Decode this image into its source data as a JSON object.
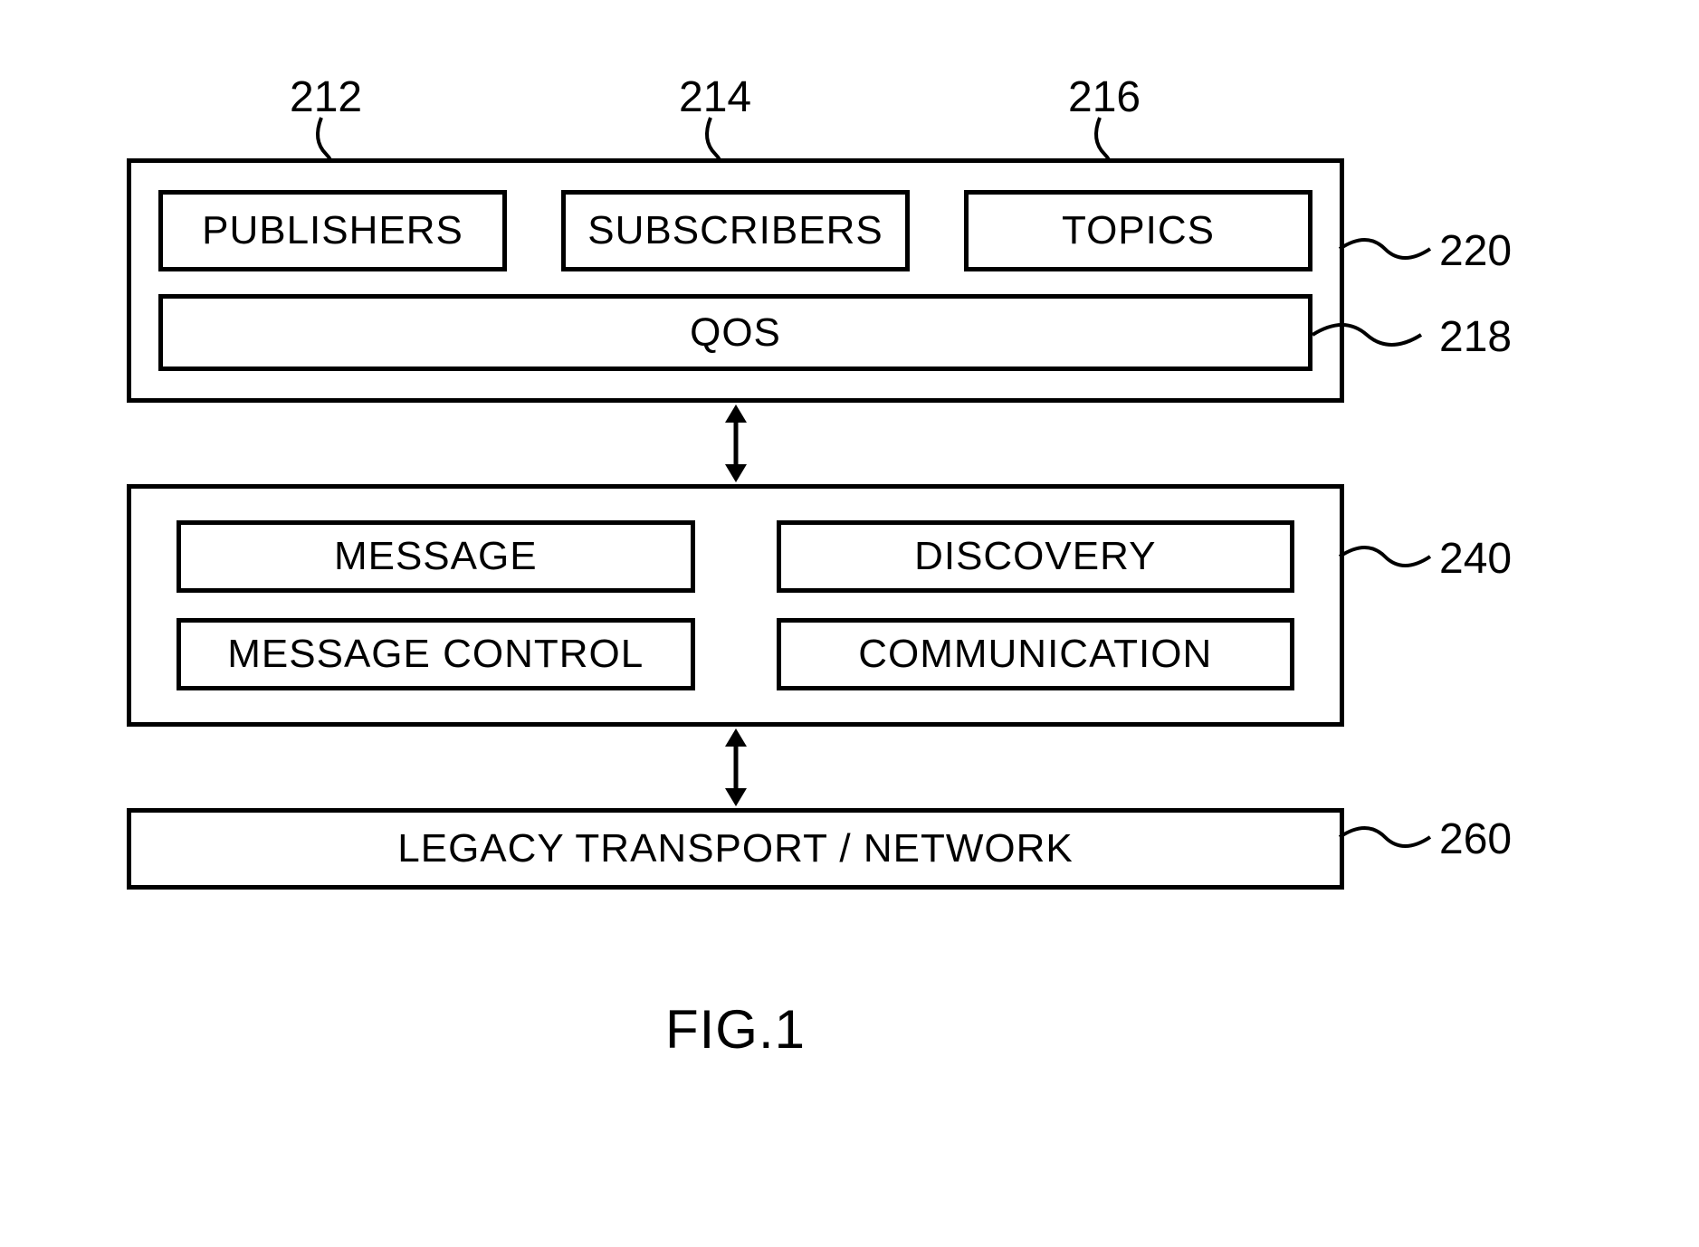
{
  "refs": {
    "r212": "212",
    "r214": "214",
    "r216": "216",
    "r218": "218",
    "r220": "220",
    "r240": "240",
    "r260": "260"
  },
  "boxes": {
    "publishers": "PUBLISHERS",
    "subscribers": "SUBSCRIBERS",
    "topics": "TOPICS",
    "qos": "QOS",
    "message": "MESSAGE",
    "discovery": "DISCOVERY",
    "message_control": "MESSAGE CONTROL",
    "communication": "COMMUNICATION",
    "legacy": "LEGACY TRANSPORT / NETWORK"
  },
  "figure": "FIG.1"
}
